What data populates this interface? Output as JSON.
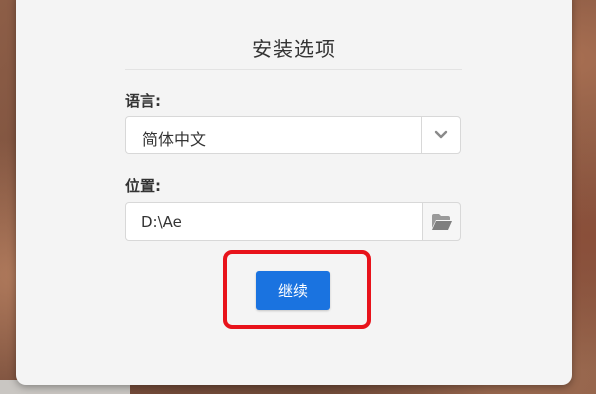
{
  "dialog": {
    "title": "安装选项",
    "language": {
      "label": "语言:",
      "selected": "简体中文"
    },
    "location": {
      "label": "位置:",
      "value": "D:\\Ae"
    },
    "continue_label": "继续"
  },
  "colors": {
    "primary_button": "#1a73e0",
    "highlight": "#e8131b",
    "dialog_bg": "#f4f4f4"
  },
  "icons": {
    "dropdown": "chevron-down-icon",
    "browse": "folder-open-icon"
  }
}
